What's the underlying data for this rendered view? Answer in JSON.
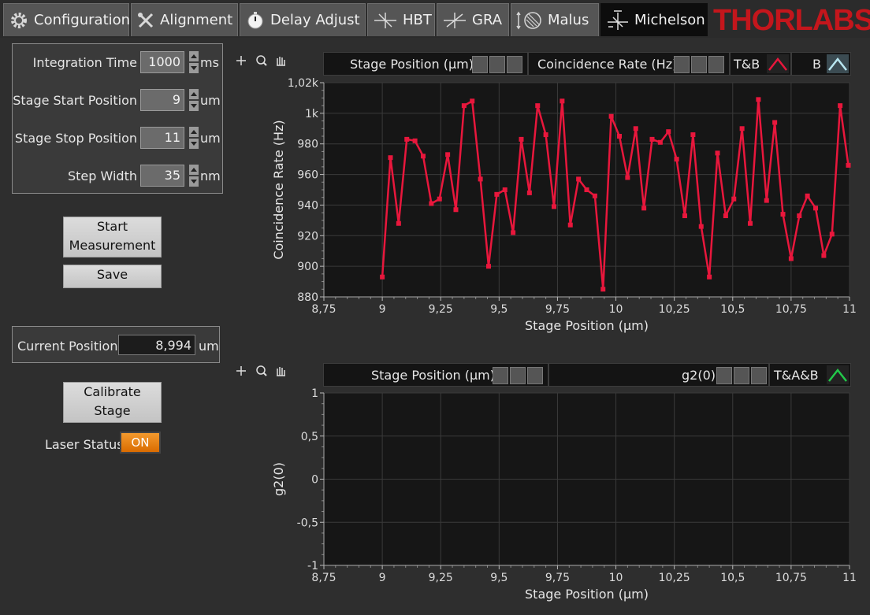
{
  "tabs": [
    {
      "label": "Configuration",
      "icon": "gear-icon"
    },
    {
      "label": "Alignment",
      "icon": "tools-icon"
    },
    {
      "label": "Delay Adjust",
      "icon": "stopwatch-icon"
    },
    {
      "label": "HBT",
      "icon": "beamsplitter-icon"
    },
    {
      "label": "GRA",
      "icon": "arrows-icon"
    },
    {
      "label": "Malus",
      "icon": "polarizer-icon"
    },
    {
      "label": "Michelson",
      "icon": "interferometer-icon"
    }
  ],
  "active_tab": "Michelson",
  "logo": "THORLABS",
  "settings": {
    "integration_time": {
      "label": "Integration Time",
      "value": "1000",
      "unit": "ms"
    },
    "stage_start": {
      "label": "Stage Start Position",
      "value": "9",
      "unit": "um"
    },
    "stage_stop": {
      "label": "Stage Stop Position",
      "value": "11",
      "unit": "um"
    },
    "step_width": {
      "label": "Step Width",
      "value": "35",
      "unit": "nm"
    }
  },
  "buttons": {
    "start_line1": "Start",
    "start_line2": "Measurement",
    "save": "Save",
    "calibrate_line1": "Calibrate",
    "calibrate_line2": "Stage"
  },
  "current_position": {
    "label": "Current Position",
    "value": "8,994",
    "unit": "um"
  },
  "laser_status": {
    "label": "Laser Status",
    "value": "ON"
  },
  "plot_top": {
    "x_legend": "Stage Position (µm)",
    "y_legend": "Coincidence Rate (Hz)",
    "series_legend": [
      {
        "name": "T&B",
        "color": "#e8173c"
      },
      {
        "name": "B",
        "color": "#b8e6f0"
      }
    ]
  },
  "plot_bottom": {
    "x_legend": "Stage Position (µm)",
    "y_legend": "g2(0)",
    "series_legend": [
      {
        "name": "T&A&B",
        "color": "#22c84a"
      }
    ]
  },
  "chart_data": [
    {
      "type": "line",
      "xlabel": "Stage Position (µm)",
      "ylabel": "Coincidence Rate (Hz)",
      "xlim": [
        8.75,
        11
      ],
      "ylim": [
        880,
        1020
      ],
      "x_ticks": [
        "8,75",
        "9",
        "9,25",
        "9,5",
        "9,75",
        "10",
        "10,25",
        "10,5",
        "10,75",
        "11"
      ],
      "y_ticks": [
        "880",
        "900",
        "920",
        "940",
        "960",
        "980",
        "1k",
        "1,02k"
      ],
      "grid": true,
      "series": [
        {
          "name": "T&B",
          "color": "#e8173c",
          "x": [
            9.0,
            9.035,
            9.07,
            9.105,
            9.14,
            9.175,
            9.21,
            9.245,
            9.28,
            9.315,
            9.35,
            9.385,
            9.42,
            9.455,
            9.49,
            9.525,
            9.56,
            9.595,
            9.63,
            9.665,
            9.7,
            9.735,
            9.77,
            9.805,
            9.84,
            9.875,
            9.91,
            9.945,
            9.98,
            10.015,
            10.05,
            10.085,
            10.12,
            10.155,
            10.19,
            10.225,
            10.26,
            10.295,
            10.33,
            10.365,
            10.4,
            10.435,
            10.47,
            10.505,
            10.54,
            10.575,
            10.61,
            10.645,
            10.68,
            10.715,
            10.75,
            10.785,
            10.82,
            10.855,
            10.89,
            10.925,
            10.96,
            10.995
          ],
          "y": [
            893,
            971,
            928,
            983,
            982,
            972,
            941,
            944,
            973,
            937,
            1005,
            1008,
            957,
            900,
            947,
            950,
            922,
            983,
            948,
            1005,
            986,
            939,
            1008,
            927,
            957,
            950,
            946,
            885,
            998,
            985,
            958,
            990,
            938,
            983,
            981,
            988,
            970,
            933,
            986,
            926,
            893,
            974,
            933,
            944,
            990,
            928,
            1009,
            943,
            994,
            934,
            905,
            933,
            946,
            938,
            907,
            921,
            1005,
            966
          ]
        }
      ]
    },
    {
      "type": "line",
      "xlabel": "Stage Position (µm)",
      "ylabel": "g2(0)",
      "xlim": [
        8.75,
        11
      ],
      "ylim": [
        -1,
        1
      ],
      "x_ticks": [
        "8,75",
        "9",
        "9,25",
        "9,5",
        "9,75",
        "10",
        "10,25",
        "10,5",
        "10,75",
        "11"
      ],
      "y_ticks": [
        "-1",
        "-0,5",
        "0",
        "0,5",
        "1"
      ],
      "grid": true,
      "series": []
    }
  ]
}
